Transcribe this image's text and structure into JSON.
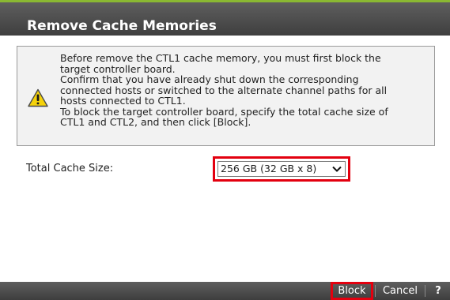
{
  "dialog": {
    "title": "Remove Cache Memories"
  },
  "message": {
    "icon": "warning-icon",
    "lines": [
      "Before remove the CTL1 cache memory, you must first block the",
      "target controller board.",
      "Confirm that you have already shut down the corresponding",
      "connected hosts or switched to the alternate channel paths for all",
      "hosts connected to CTL1.",
      "To block the target controller board, specify the total cache size of",
      "CTL1 and CTL2, and then click [Block]."
    ]
  },
  "cache_size": {
    "label": "Total Cache Size:",
    "selected": "256 GB (32 GB x 8)"
  },
  "buttons": {
    "block": "Block",
    "cancel": "Cancel",
    "help": "?"
  },
  "colors": {
    "title_bar": "#4a4a4a",
    "highlight": "#e3000f",
    "accent_line": "#8ab832",
    "warning_fill": "#f5d20a"
  }
}
